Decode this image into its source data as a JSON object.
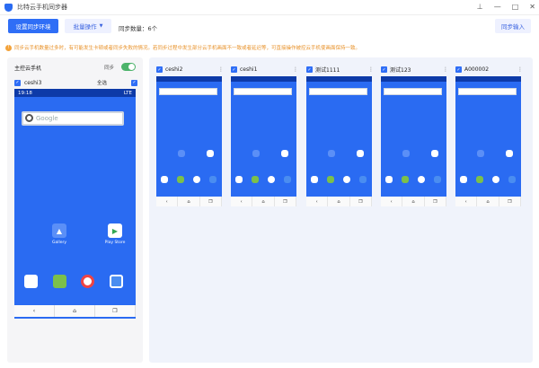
{
  "window": {
    "title": "比特云手机同步器"
  },
  "toolbar": {
    "setup_label": "设置同步环境",
    "batch_label": "批量操作",
    "sync_count_label": "同步数量：",
    "sync_count_value": "6个",
    "input_label": "同步输入"
  },
  "notice": {
    "text": "同步云手机数量过多时，有可能发生卡顿或者同步失败的情况。若同步过程中发生部分云手机画面不一致或者延迟等，可直接操作被控云手机使画面保持一致。"
  },
  "main": {
    "header": "主控云手机",
    "sync_label": "同步",
    "device_name": "ceshi3",
    "select_all": "全选",
    "time": "19:18",
    "network": "LTE",
    "search_placeholder": "Google",
    "apps": [
      {
        "label": "Gallery"
      },
      {
        "label": "Play Store"
      }
    ]
  },
  "devices": [
    {
      "name": "ceshi2"
    },
    {
      "name": "ceshi1"
    },
    {
      "name": "测试1111"
    },
    {
      "name": "测试123"
    },
    {
      "name": "A000002"
    }
  ],
  "colors": {
    "accent": "#2f6ef6",
    "screen": "#2a6bf2",
    "warn": "#e8922a",
    "toggle": "#4cb36a"
  }
}
